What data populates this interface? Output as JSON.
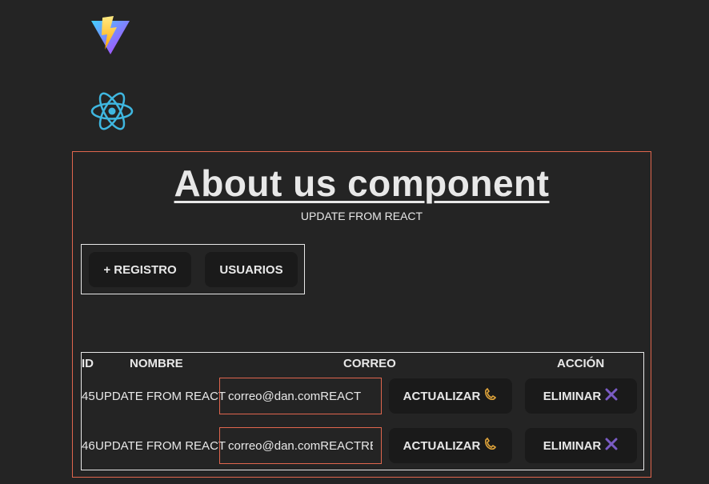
{
  "app": {
    "logos": [
      "vite-logo",
      "react-logo"
    ]
  },
  "about": {
    "title": "About us component",
    "subtitle": "UPDATE FROM REACT"
  },
  "nav": {
    "registro_label": "+ REGISTRO",
    "usuarios_label": "USUARIOS"
  },
  "table": {
    "headers": {
      "id": "ID",
      "nombre": "NOMBRE",
      "correo": "CORREO",
      "accion": "ACCIÓN"
    },
    "rows": [
      {
        "id": "45",
        "nombre": "UPDATE FROM REACT",
        "correo": "correo@dan.comREACT",
        "actualizar": "ACTUALIZAR",
        "eliminar": "ELIMINAR"
      },
      {
        "id": "46",
        "nombre": "UPDATE FROM REACT",
        "correo": "correo@dan.comREACTREACT",
        "actualizar": "ACTUALIZAR",
        "eliminar": "ELIMINAR"
      }
    ]
  },
  "icons": {
    "update": "phone-hook-icon",
    "delete": "x-mark-icon"
  },
  "colors": {
    "background": "#242424",
    "accent_border": "#e0664e",
    "button_bg": "#1a1a1a",
    "delete_icon": "#7a5cc4",
    "update_icon": "#e0a43a"
  }
}
